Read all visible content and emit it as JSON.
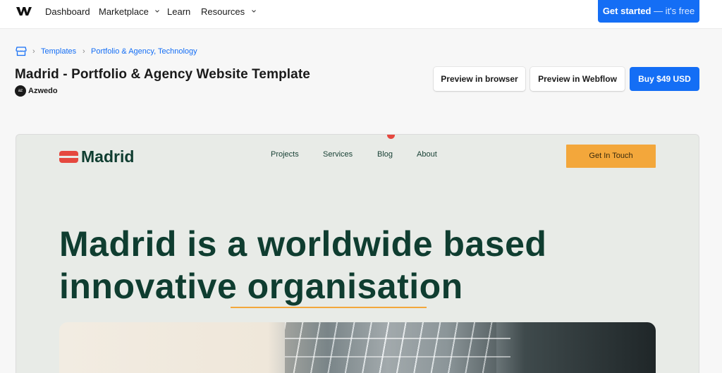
{
  "topnav": {
    "logo_icon": "webflow-logo-icon",
    "items": [
      {
        "label": "Dashboard",
        "has_dropdown": false
      },
      {
        "label": "Marketplace",
        "has_dropdown": true
      },
      {
        "label": "Learn",
        "has_dropdown": false
      },
      {
        "label": "Resources",
        "has_dropdown": true
      }
    ],
    "cta_main": "Get started",
    "cta_sub": " — it's free",
    "cta_color": "#146ef5"
  },
  "breadcrumb": {
    "icon": "marketplace-icon",
    "items": [
      {
        "label": "Templates"
      },
      {
        "label": "Portfolio & Agency, Technology"
      }
    ]
  },
  "template": {
    "title": "Madrid - Portfolio & Agency Website Template",
    "author_initials": "az",
    "author": "Azwedo",
    "actions": {
      "preview_browser": "Preview in browser",
      "preview_webflow": "Preview in Webflow",
      "buy": "Buy  $49 USD"
    }
  },
  "preview": {
    "site_logo_text": "Madrid",
    "nav": [
      "Projects",
      "Services",
      "Blog",
      "About"
    ],
    "cta": "Get In Touch",
    "hero_line_1": "Madrid is a worldwide based",
    "hero_line_2": "innovative organisation",
    "colors": {
      "brand_green": "#0f3d30",
      "accent_orange": "#f3a73b",
      "logo_red": "#e5483f",
      "background": "#e8ebe7"
    }
  }
}
